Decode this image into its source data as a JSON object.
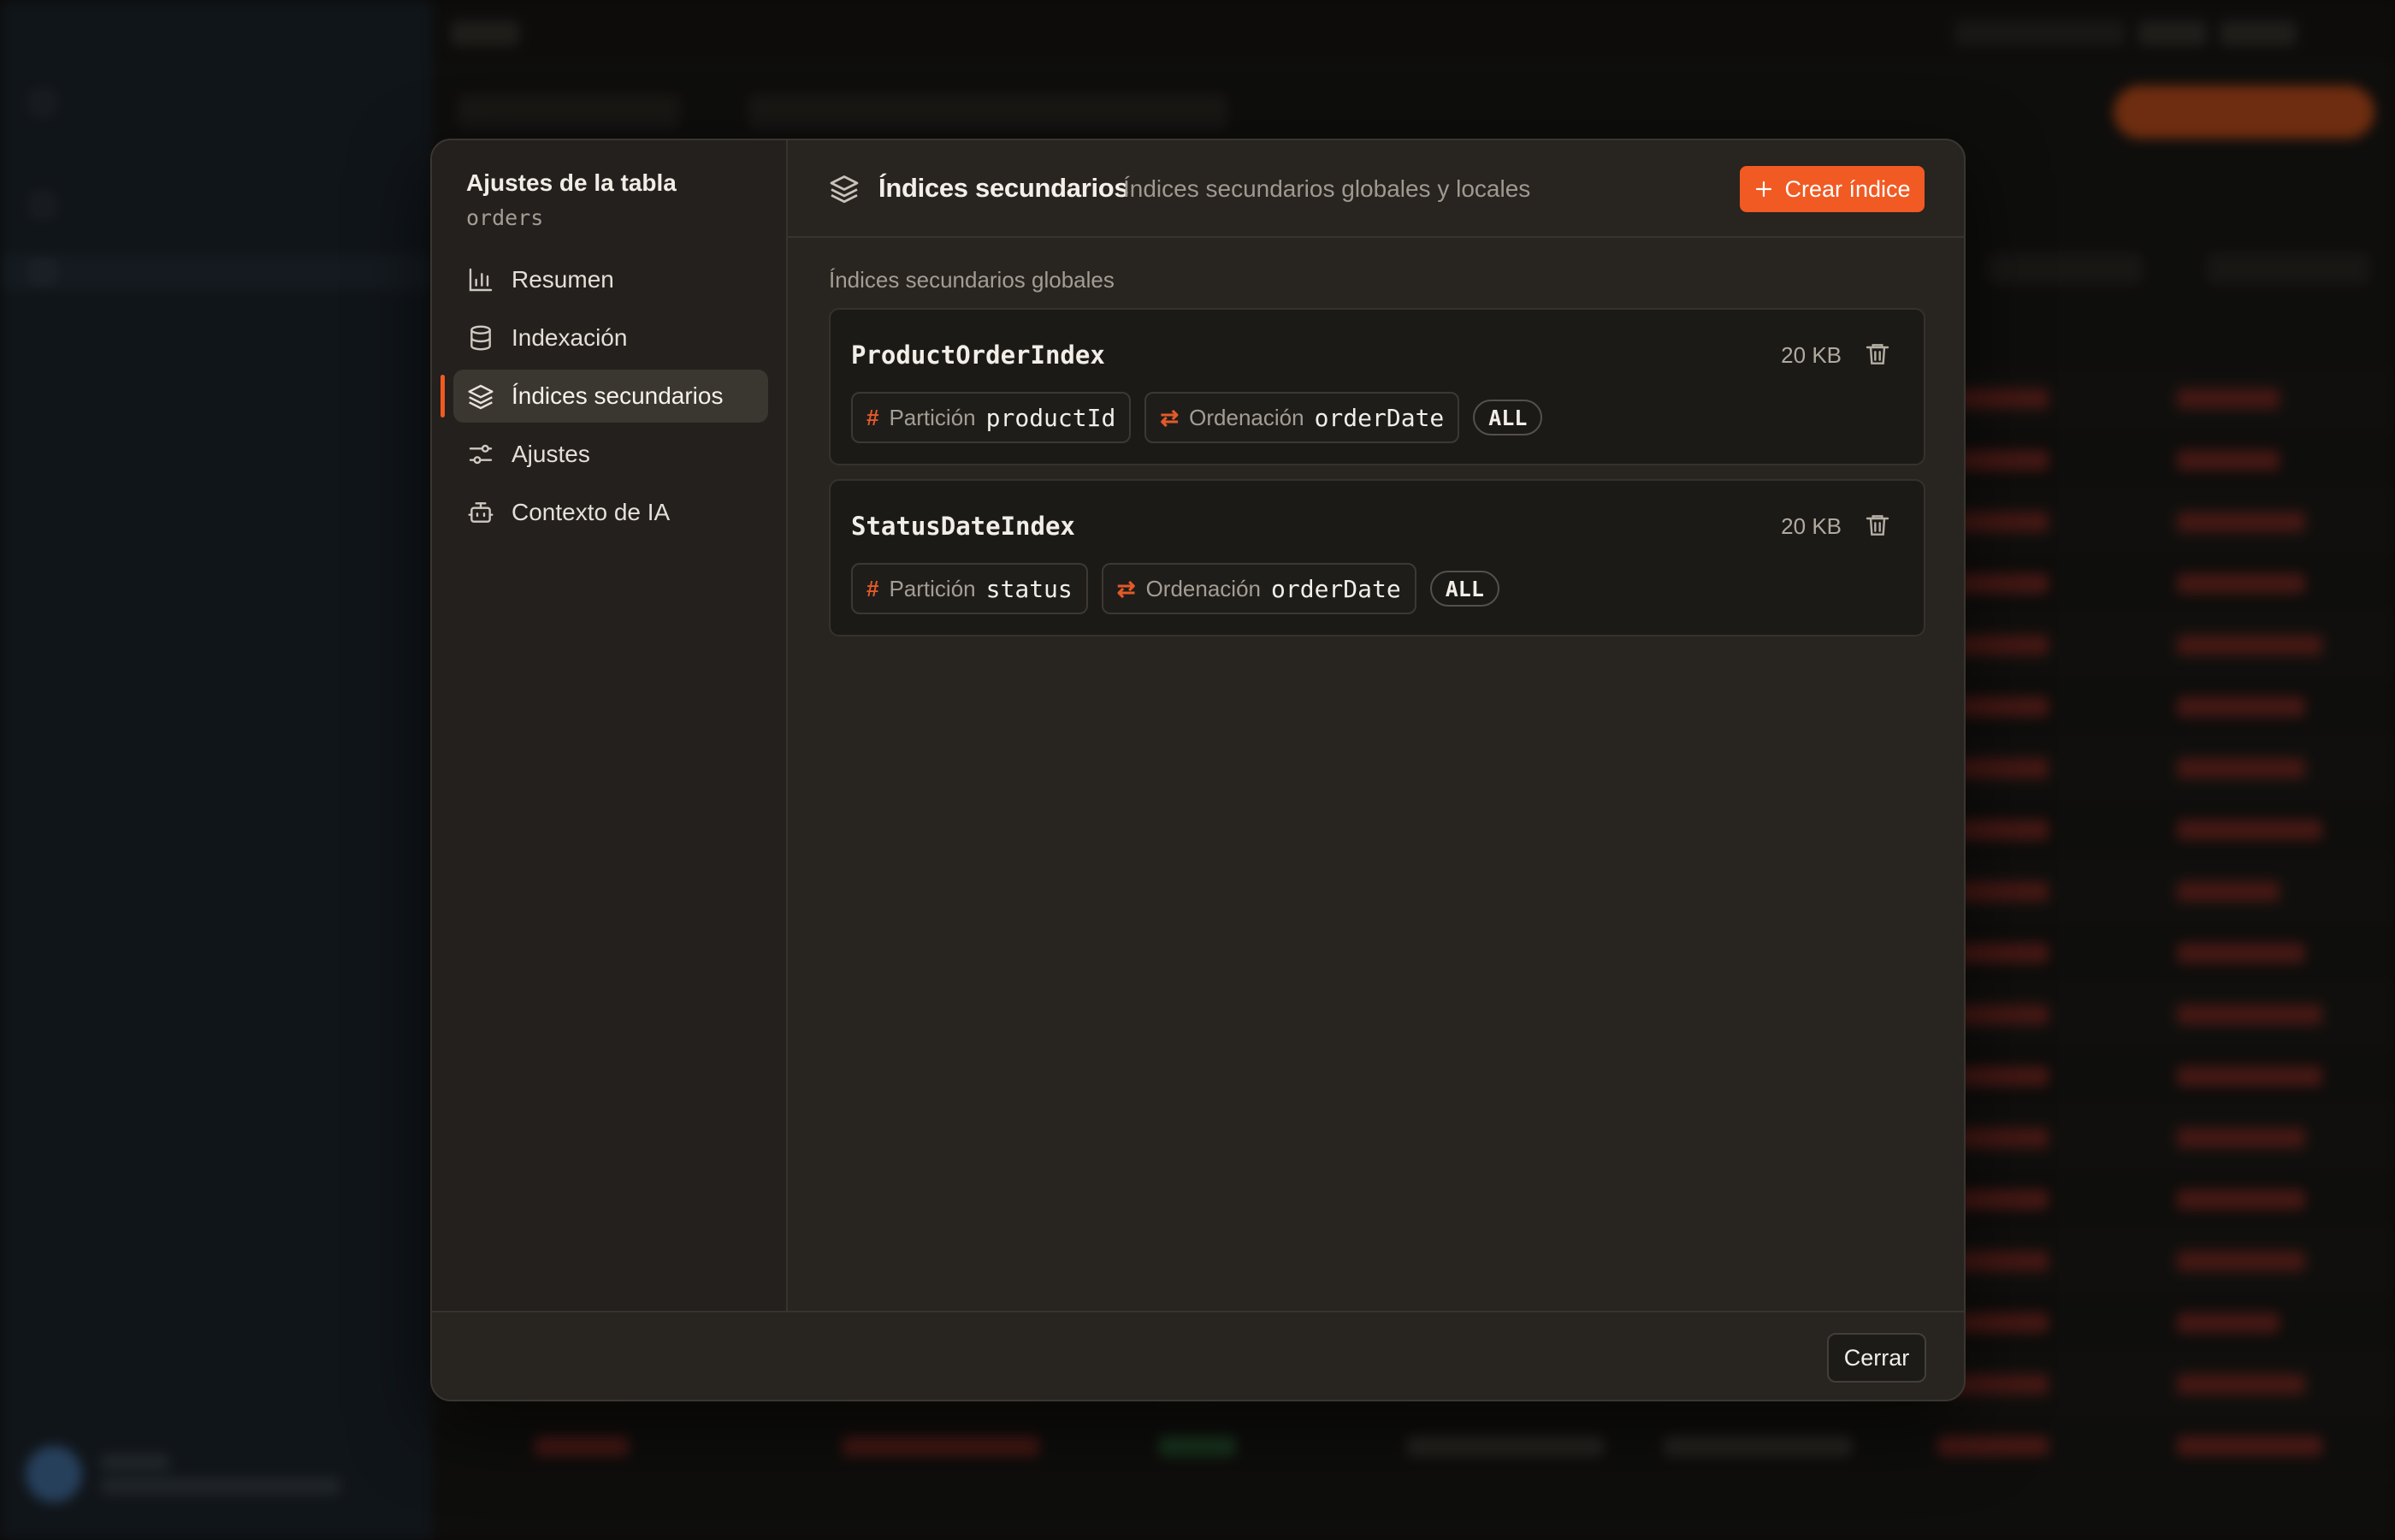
{
  "modal": {
    "nav": {
      "title": "Ajustes de la tabla",
      "table_name": "orders",
      "items": [
        {
          "label": "Resumen",
          "icon": "bar-chart-icon",
          "active": false
        },
        {
          "label": "Indexación",
          "icon": "database-icon",
          "active": false
        },
        {
          "label": "Índices secundarios",
          "icon": "layers-icon",
          "active": true
        },
        {
          "label": "Ajustes",
          "icon": "sliders-icon",
          "active": false
        },
        {
          "label": "Contexto de IA",
          "icon": "bot-icon",
          "active": false
        }
      ]
    },
    "header": {
      "title": "Índices secundarios",
      "subtitle": "Índices secundarios globales y locales",
      "create_label": "Crear índice"
    },
    "section_label": "Índices secundarios globales",
    "indexes": [
      {
        "name": "ProductOrderIndex",
        "size": "20 KB",
        "partition_label": "Partición",
        "partition_key": "productId",
        "sort_label": "Ordenación",
        "sort_key": "orderDate",
        "projection": "ALL"
      },
      {
        "name": "StatusDateIndex",
        "size": "20 KB",
        "partition_label": "Partición",
        "partition_key": "status",
        "sort_label": "Ordenación",
        "sort_key": "orderDate",
        "projection": "ALL"
      }
    ],
    "footer": {
      "close_label": "Cerrar"
    }
  },
  "colors": {
    "accent": "#f15a22",
    "modal_bg": "#282420",
    "card_bg": "#1c1a17"
  }
}
